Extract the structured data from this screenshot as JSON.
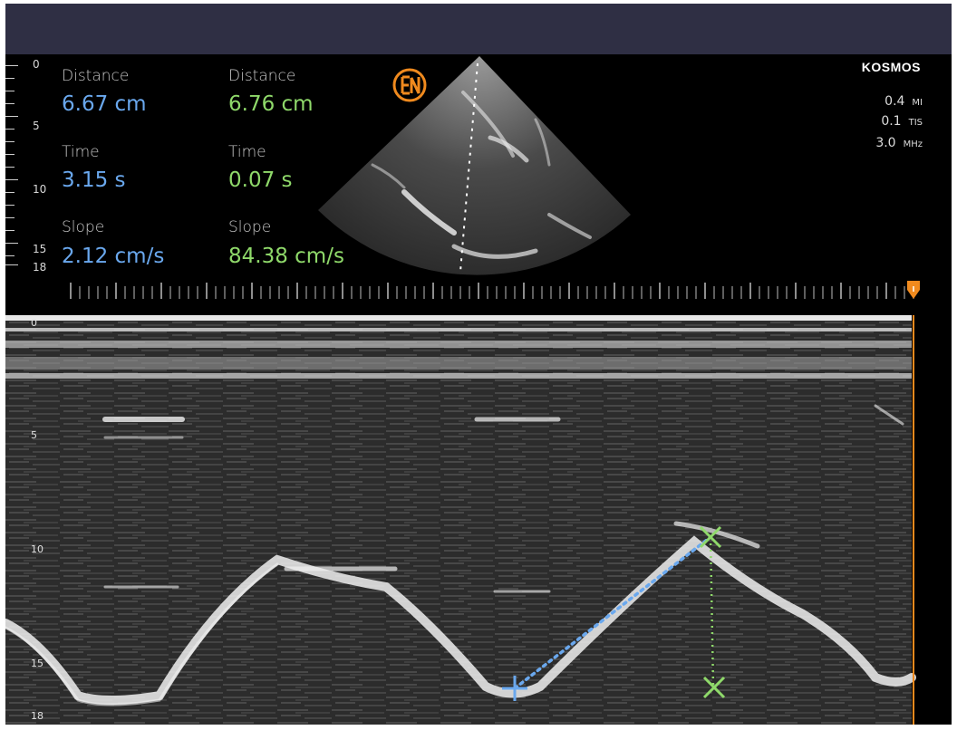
{
  "brand": "KOSMOS",
  "measurements": {
    "blue": {
      "distance_label": "Distance",
      "distance_value": "6.67 cm",
      "time_label": "Time",
      "time_value": "3.15 s",
      "slope_label": "Slope",
      "slope_value": "2.12 cm/s"
    },
    "green": {
      "distance_label": "Distance",
      "distance_value": "6.76 cm",
      "time_label": "Time",
      "time_value": "0.07 s",
      "slope_label": "Slope",
      "slope_value": "84.38 cm/s"
    }
  },
  "params": [
    {
      "value": "0.4",
      "unit": "MI"
    },
    {
      "value": "0.1",
      "unit": "TIS"
    },
    {
      "value": "3.0",
      "unit": "MHz"
    }
  ],
  "depth_scale_labels": [
    "0",
    "5",
    "10",
    "15",
    "18"
  ],
  "mmode_depth_labels": [
    "0",
    "5",
    "10",
    "15",
    "18"
  ],
  "colors": {
    "blue": "#6aa8ee",
    "green": "#8fd96a",
    "orange": "#f08a1e",
    "topbar": "#2f2f44"
  },
  "icons": {
    "logo": "en-logo-icon",
    "timeline_marker": "playhead-marker-icon",
    "blue_caliper": "plus-caliper-icon",
    "green_caliper": "x-caliper-icon"
  }
}
